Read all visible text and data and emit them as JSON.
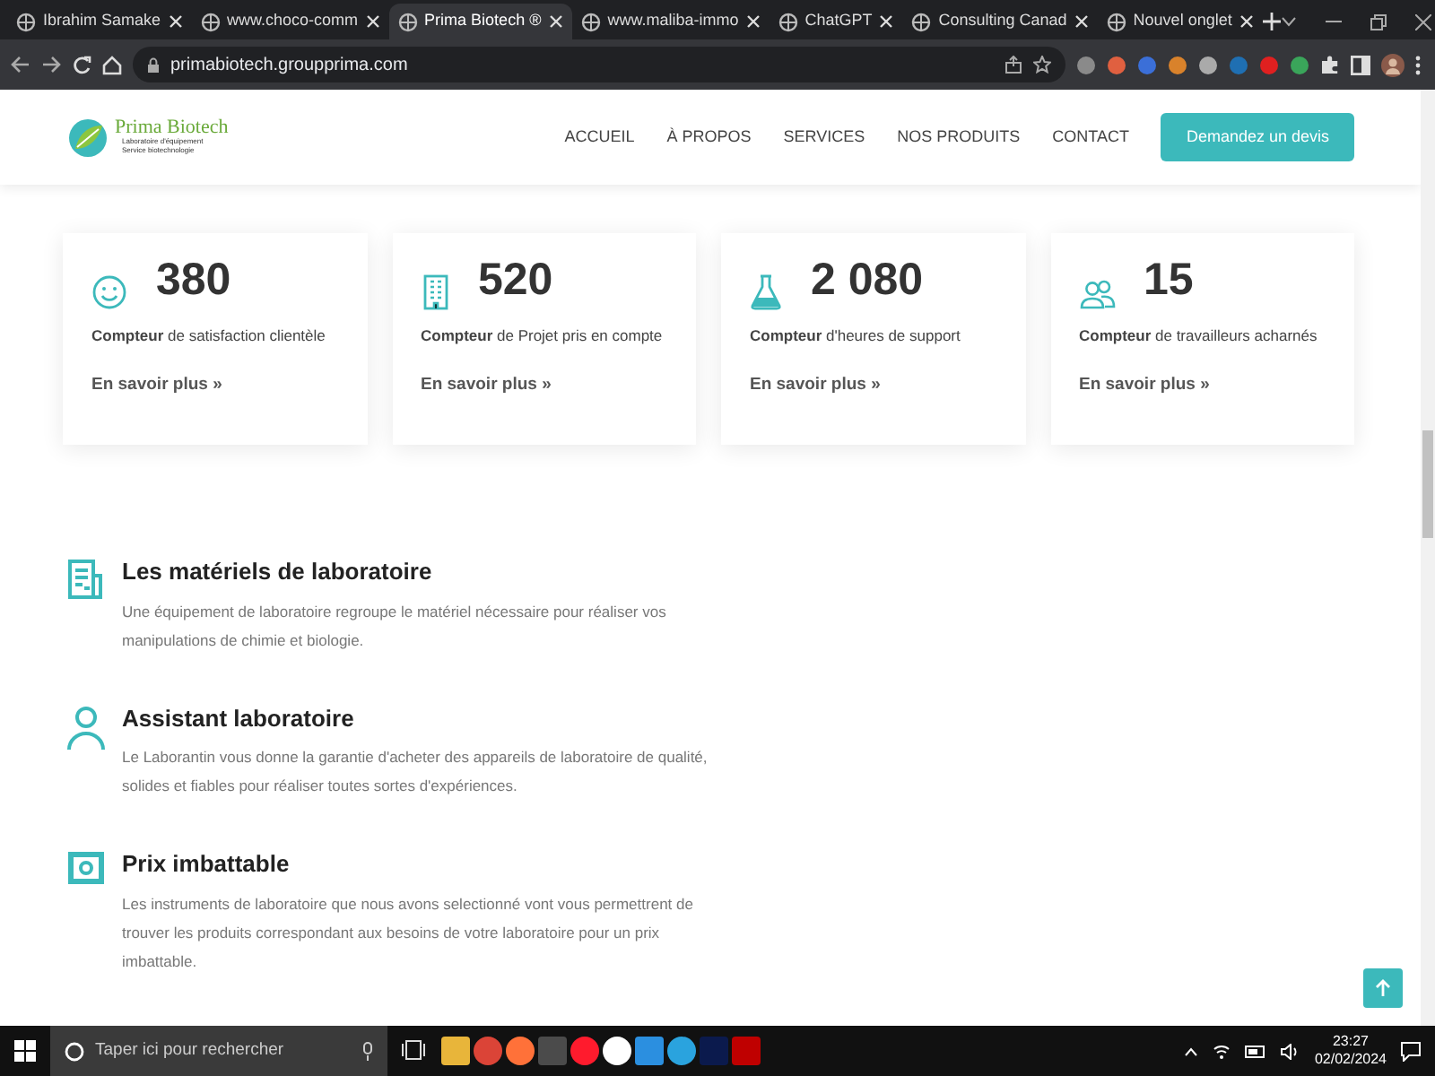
{
  "browser": {
    "tabs": [
      {
        "title": "Ibrahim Samake",
        "selected": false
      },
      {
        "title": "www.choco-comm",
        "selected": false
      },
      {
        "title": "Prima Biotech ®",
        "selected": true
      },
      {
        "title": "www.maliba-immo",
        "selected": false
      },
      {
        "title": "ChatGPT",
        "selected": false
      },
      {
        "title": "Consulting Canad",
        "selected": false
      },
      {
        "title": "Nouvel onglet",
        "selected": false
      }
    ],
    "url": "primabiotech.groupprima.com"
  },
  "site": {
    "logo": {
      "name": "Prima Biotech",
      "tagline": "Laboratoire d'équipement",
      "tagline_2": "Service biotechnologie"
    },
    "nav": [
      "ACCUEIL",
      "À PROPOS",
      "SERVICES",
      "NOS PRODUITS",
      "CONTACT"
    ],
    "cta": "Demandez un devis",
    "counters": [
      {
        "kind": "smile",
        "value": "380",
        "label": "**Compteur** de satisfaction clientèle",
        "link": "En savoir plus »"
      },
      {
        "kind": "building",
        "value": "520",
        "label": "**Compteur** de Projet pris en compte",
        "link": "En savoir plus »"
      },
      {
        "kind": "flask",
        "value": "2 080",
        "label": "**Compteur** d'heures de support",
        "link": "En savoir plus »"
      },
      {
        "kind": "people",
        "value": "15",
        "label": "**Compteur** de travailleurs acharnés",
        "link": "En savoir plus »"
      }
    ],
    "features": [
      {
        "kind": "document",
        "title": "Les matériels de laboratoire",
        "text": "Une équipement de laboratoire regroupe le matériel nécessaire pour réaliser vos manipulations de chimie et biologie."
      },
      {
        "kind": "person",
        "title": "Assistant laboratoire",
        "text": "Le Laborantin vous donne la garantie d'acheter des appareils de laboratoire de qualité, solides et fiables pour réaliser toutes sortes d'expériences."
      },
      {
        "kind": "banknote",
        "title": "Prix imbattable",
        "text": "Les instruments de laboratoire que nous avons selectionné vont vous permettrent de trouver les produits correspondant aux besoins de votre laboratoire pour un prix imbattable."
      }
    ]
  },
  "taskbar": {
    "search": {
      "placeholder": "Taper ici pour rechercher"
    },
    "time": "23:27",
    "date": "02/02/2024"
  }
}
